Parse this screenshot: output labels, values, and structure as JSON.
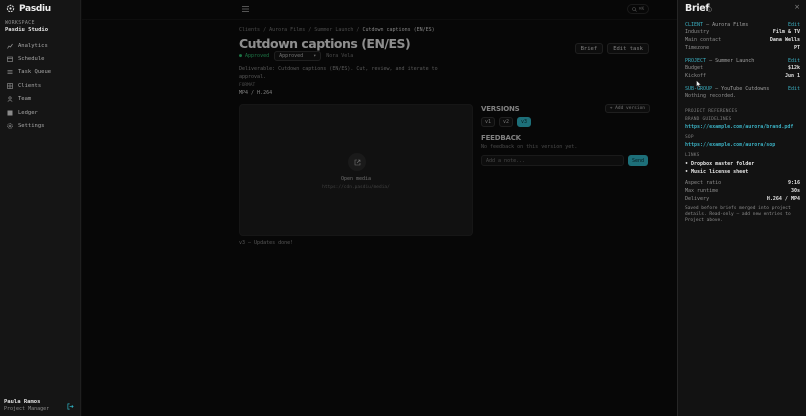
{
  "sidebar": {
    "app_name": "Pasdiu",
    "workspace_label": "WORKSPACE",
    "workspace_name": "Pasdiu Studio",
    "items": [
      {
        "label": "Analytics",
        "icon": "chart-icon"
      },
      {
        "label": "Schedule",
        "icon": "calendar-icon"
      },
      {
        "label": "Task Queue",
        "icon": "list-icon"
      },
      {
        "label": "Clients",
        "icon": "grid-icon"
      },
      {
        "label": "Team",
        "icon": "users-icon"
      },
      {
        "label": "Ledger",
        "icon": "ledger-icon"
      },
      {
        "label": "Settings",
        "icon": "settings-icon"
      }
    ],
    "user": {
      "name": "Paula Ramos",
      "role": "Project Manager"
    }
  },
  "topbar": {
    "search_shortcut": "⌘K"
  },
  "task": {
    "breadcrumb": [
      "Clients",
      "Aurora Films",
      "Summer Launch",
      "Cutdown captions (EN/ES)"
    ],
    "title": "Cutdown captions (EN/ES)",
    "status_badge": "● Approved",
    "status_select": "Approved",
    "owner": "Nora Vela",
    "actions": {
      "brief": "Brief",
      "edit": "Edit task"
    },
    "description": "Deliverable: Cutdown captions (EN/ES). Cut, review, and iterate to approval.",
    "format_label": "FORMAT",
    "format_value": "MP4 / H.264",
    "media": {
      "open_label": "Open media",
      "url": "https://cdn.pasdiu/media/"
    },
    "version_note": "v3 — Updates done!"
  },
  "versions": {
    "title": "VERSIONS",
    "add_label": "+ Add version",
    "chips": [
      "v1",
      "v2",
      "v3"
    ],
    "active": "v3"
  },
  "feedback": {
    "title": "FEEDBACK",
    "empty_text": "No feedback on this version yet.",
    "input_placeholder": "Add a note...",
    "send_label": "Send"
  },
  "brief": {
    "title": "Brief",
    "close": "×",
    "client": {
      "key": "CLIENT",
      "value": "— Aurora Films",
      "edit": "Edit"
    },
    "client_rows": [
      {
        "label": "Industry",
        "value": "Film & TV"
      },
      {
        "label": "Main contact",
        "value": "Dana Wells"
      },
      {
        "label": "Timezone",
        "value": "PT"
      }
    ],
    "project": {
      "key": "PROJECT",
      "value": "— Summer Launch",
      "edit": "Edit"
    },
    "project_rows": [
      {
        "label": "Budget",
        "value": "$12k"
      },
      {
        "label": "Kickoff",
        "value": "Jun 1"
      }
    ],
    "subgroup": {
      "key": "SUB-GROUP",
      "value": "— YouTube Cutdowns",
      "edit": "Edit"
    },
    "subgroup_text": "Nothing recorded.",
    "references_label": "PROJECT REFERENCES",
    "brand_label": "BRAND GUIDELINES",
    "brand_link": "https://example.com/aurora/brand.pdf",
    "sop_label": "SOP",
    "sop_link": "https://example.com/aurora/sop",
    "links_label": "LINKS",
    "links": [
      "• Dropbox master folder",
      "• Music license sheet"
    ],
    "spec_rows": [
      {
        "label": "Aspect ratio",
        "value": "9:16"
      },
      {
        "label": "Max runtime",
        "value": "30s"
      },
      {
        "label": "Delivery",
        "value": "H.264 / MP4"
      }
    ],
    "footnote": "Saved before briefs merged into project details. Read-only — add new entries to Project above."
  }
}
